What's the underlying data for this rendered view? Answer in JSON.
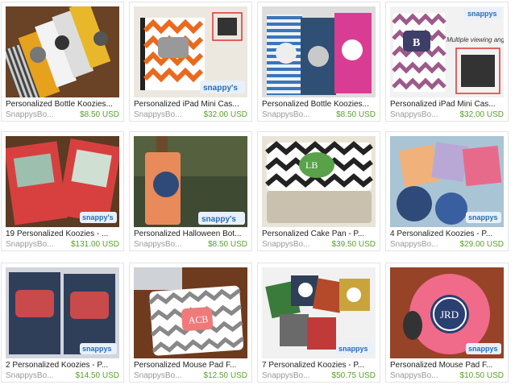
{
  "listings": [
    {
      "title": "Personalized Bottle Koozies...",
      "shop": "SnappysBo...",
      "price": "$8.50 USD",
      "logo": "snappy's",
      "img": "bottle-koozies-chevron"
    },
    {
      "title": "Personalized iPad Mini Cas...",
      "shop": "SnappysBo...",
      "price": "$32.00 USD",
      "logo": "snappy's",
      "img": "ipad-case-orange-chevron"
    },
    {
      "title": "Personalized Bottle Koozies...",
      "shop": "SnappysBo...",
      "price": "$8.50 USD",
      "logo": "",
      "img": "bottle-koozies-stripes"
    },
    {
      "title": "Personalized iPad Mini Cas...",
      "shop": "SnappysBo...",
      "price": "$32.00 USD",
      "logo": "snappys",
      "img": "ipad-case-purple-chevron",
      "overlay_text": "Multiple viewing ang"
    },
    {
      "title": "19 Personalized Koozies - ...",
      "shop": "SnappysBo...",
      "price": "$131.00 USD",
      "logo": "snappy's",
      "img": "koozies-red-anchor"
    },
    {
      "title": "Personalized Halloween Bot...",
      "shop": "SnappysBo...",
      "price": "$8.50 USD",
      "logo": "snappy's",
      "img": "halloween-bottle"
    },
    {
      "title": "Personalized Cake Pan - P...",
      "shop": "SnappysBo...",
      "price": "$39.50 USD",
      "logo": "",
      "img": "cake-pan-chevron"
    },
    {
      "title": "4 Personalized Koozies - P...",
      "shop": "SnappysBo...",
      "price": "$29.00 USD",
      "logo": "snappys",
      "img": "koozies-pastel"
    },
    {
      "title": "2 Personalized Koozies - P...",
      "shop": "SnappysBo...",
      "price": "$14.50 USD",
      "logo": "snappys",
      "img": "koozies-navy-anchor"
    },
    {
      "title": "Personalized Mouse Pad F...",
      "shop": "SnappysBo...",
      "price": "$12.50 USD",
      "logo": "",
      "img": "mouse-pad-grey-chevron"
    },
    {
      "title": "7 Personalized Koozies - P...",
      "shop": "SnappysBo...",
      "price": "$50.75 USD",
      "logo": "snappys",
      "img": "koozies-mixed"
    },
    {
      "title": "Personalized Mouse Pad F...",
      "shop": "SnappysBo...",
      "price": "$10.50 USD",
      "logo": "snappys",
      "img": "mouse-pad-pink-anchor"
    }
  ],
  "colors": {
    "price": "#5aa02c",
    "title": "#222222",
    "shop": "#999999",
    "border": "#e4e4e4"
  }
}
